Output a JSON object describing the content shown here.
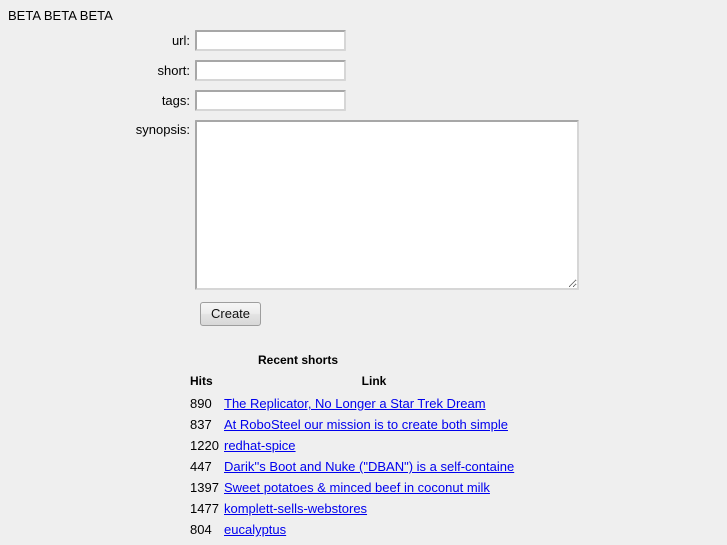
{
  "heading": "BETA BETA BETA",
  "form": {
    "fields": [
      {
        "label": "url:",
        "name": "url-input",
        "value": "",
        "placeholder": ""
      },
      {
        "label": "short:",
        "name": "short-input",
        "value": "",
        "placeholder": ""
      },
      {
        "label": "tags:",
        "name": "tags-input",
        "value": "",
        "placeholder": ""
      }
    ],
    "synopsis": {
      "label": "synopsis:",
      "value": "",
      "placeholder": ""
    },
    "submit_label": "Create"
  },
  "recent": {
    "title": "Recent shorts",
    "columns": {
      "hits": "Hits",
      "link": "Link"
    },
    "rows": [
      {
        "hits": "890",
        "link": "The Replicator, No Longer a Star Trek Dream"
      },
      {
        "hits": "837",
        "link": "At RoboSteel our mission is to create both simple"
      },
      {
        "hits": "1220",
        "link": "redhat-spice"
      },
      {
        "hits": "447",
        "link": "Darik''s Boot and Nuke (\"DBAN\") is a self-containe"
      },
      {
        "hits": "1397",
        "link": "Sweet potatoes & minced beef in coconut milk"
      },
      {
        "hits": "1477",
        "link": "komplett-sells-webstores"
      },
      {
        "hits": "804",
        "link": "eucalyptus"
      }
    ]
  },
  "colors": {
    "page_background": "#efefef",
    "link": "#0000ee",
    "text": "#000000",
    "input_background": "#ffffff",
    "input_border": "#a7a7a7"
  }
}
